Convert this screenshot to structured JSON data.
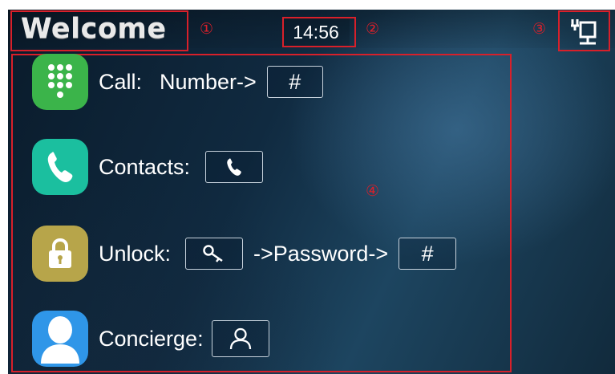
{
  "header": {
    "title": "Welcome",
    "time": "14:56",
    "network_icon": "network-wired-icon"
  },
  "annotations": {
    "m1": "①",
    "m2": "②",
    "m3": "③",
    "m4": "④"
  },
  "rows": [
    {
      "icon": "dialpad-icon",
      "icon_color": "#3bb44a",
      "label": "Call:",
      "text1": "Number->",
      "key": "#"
    },
    {
      "icon": "phone-icon",
      "icon_color": "#1bbf9f",
      "label": "Contacts:",
      "key_icon": "phone-icon"
    },
    {
      "icon": "padlock-icon",
      "icon_color": "#b7a54a",
      "label": "Unlock:",
      "key_icon": "key-icon",
      "text1": "->Password->",
      "key": "#"
    },
    {
      "icon": "person-icon",
      "icon_color": "#2f96e8",
      "label": "Concierge:",
      "key_icon": "person-outline-icon"
    }
  ],
  "colors": {
    "annotation_red": "#d8202a",
    "background": "#102a40",
    "text": "#ffffff"
  }
}
